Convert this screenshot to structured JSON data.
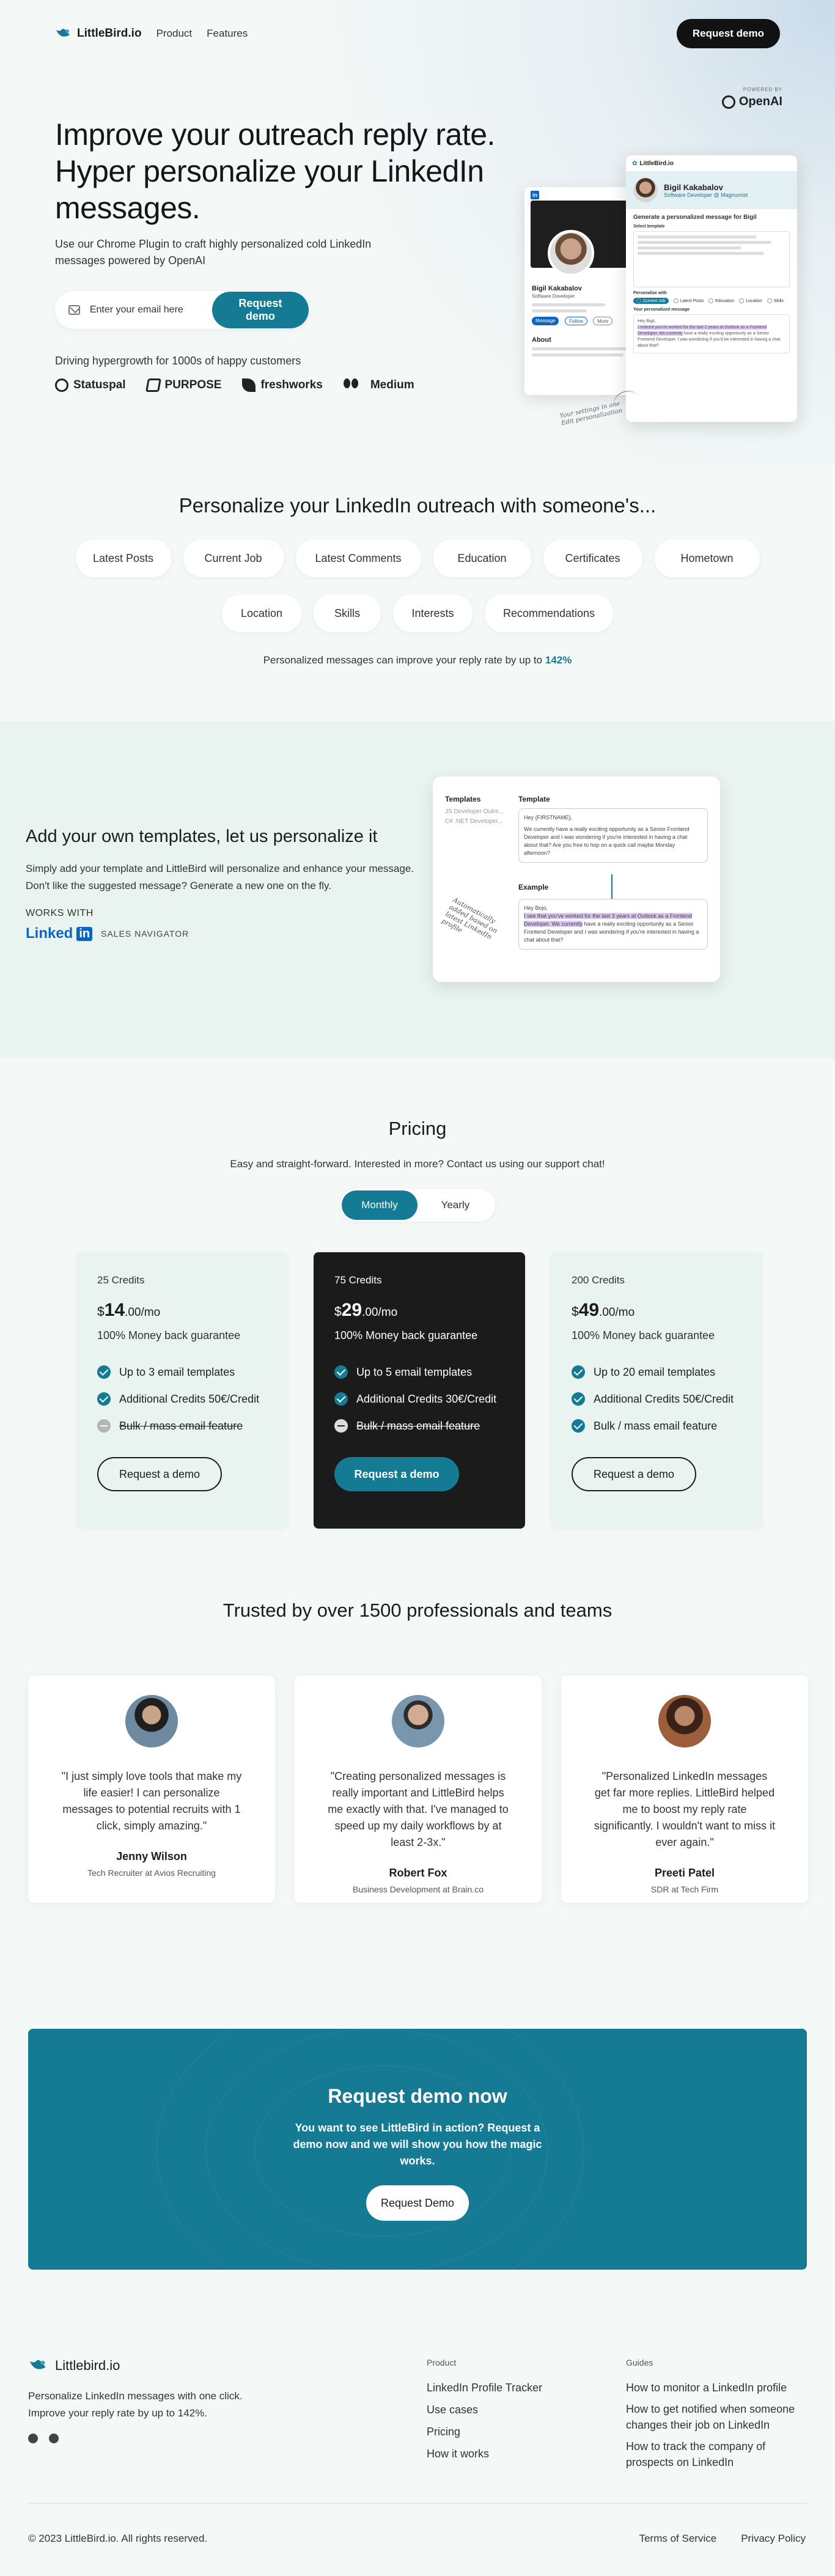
{
  "nav": {
    "logo": "LittleBird.io",
    "links": [
      "Product",
      "Features"
    ],
    "cta": "Request demo"
  },
  "powered": {
    "label": "POWERED BY",
    "brand": "OpenAI"
  },
  "hero": {
    "headline": "Improve your outreach reply rate. Hyper personalize your LinkedIn messages.",
    "subtitle": "Use our Chrome Plugin to craft highly personalized cold LinkedIn messages powered by OpenAI",
    "email_placeholder": "Enter your email here",
    "email_button": "Request demo",
    "driving": "Driving hypergrowth for 1000s of happy customers",
    "customers": [
      "Statuspal",
      "PURPOSE",
      "freshworks",
      "Medium"
    ],
    "mock": {
      "app_name": "LittleBird.io",
      "profile_name": "Bigil Kakabalov",
      "profile_role": "Software Developer @ Magnumist",
      "section_title": "Generate a personalized message for Bigil",
      "select_template": "Select template",
      "personalize_with": "Personalize with",
      "options": [
        "Current Job",
        "Latest Posts",
        "Education",
        "Location",
        "Skills"
      ],
      "message_label": "Your personalized message",
      "message_greeting": "Hey Bigil,",
      "message_highlight": "I noticed you've worked for the last 2 years at Outlook as a Frontend Developer. Ms currently",
      "message_rest": "have a really exciting opportunity as a Senior Frontend Developer. I was wondering if you'd be interested in having a chat about that?",
      "back_name": "Bigil Kakabalov",
      "back_role": "Software Developer",
      "back_about": "About",
      "back_button": "Message",
      "back_follow": "Follow",
      "back_more": "More"
    },
    "handwriting": "Your settings in one Edit personalization"
  },
  "personalize": {
    "title": "Personalize your LinkedIn outreach with someone's...",
    "chips": [
      "Latest Posts",
      "Current Job",
      "Latest Comments",
      "Education",
      "Certificates",
      "Hometown",
      "Location",
      "Skills",
      "Interests",
      "Recommendations"
    ],
    "footer_text": "Personalized messages can improve your reply rate by up to",
    "footer_value": "142%"
  },
  "templates": {
    "title": "Add your own templates, let us personalize it",
    "description": "Simply add your template and LittleBird will personalize and enhance your message. Don't like the suggested message? Generate a new one on the fly.",
    "works_with": "WORKS WITH",
    "linkedin_word": "Linked",
    "linkedin_box": "in",
    "sales_navigator": "SALES NAVIGATOR",
    "card": {
      "col_templates": "Templates",
      "col_template": "Template",
      "list": [
        "JS Developer Outre...",
        "C# .NET Developer..."
      ],
      "template_greeting": "Hey {FIRSTNAME},",
      "template_body": "We currently have a really exciting opportunity as a Senior Frontend Developer and I was wondering if you're interested in having a chat about that? Are you free to hop on a quick call maybe Monday afternoon?",
      "example_label": "Example",
      "example_greeting": "Hey Bojo,",
      "example_highlight": "I see that you've worked for the last 3 years at Outlook as a Frontend Developer. We currently",
      "example_rest": "have a really exciting opportunity as a Senior Frontend Developer and I was wondering if you're interested in having a chat about that?",
      "handwriting": "Automatically added based on latest LinkedIn profile"
    }
  },
  "pricing": {
    "title": "Pricing",
    "subtitle": "Easy and straight-forward. Interested in more? Contact us using our support chat!",
    "toggle": [
      "Monthly",
      "Yearly"
    ],
    "plans": [
      {
        "credits": "25 Credits",
        "currency": "$",
        "amount": "14",
        "cents": ".00/mo",
        "guarantee": "100% Money back guarantee",
        "features": [
          {
            "text": "Up to 3 email templates",
            "included": true
          },
          {
            "text": "Additional Credits 50€/Credit",
            "included": true
          },
          {
            "text": "Bulk / mass email feature",
            "included": false
          }
        ],
        "button": "Request a demo"
      },
      {
        "credits": "75 Credits",
        "currency": "$",
        "amount": "29",
        "cents": ".00/mo",
        "guarantee": "100% Money back guarantee",
        "features": [
          {
            "text": "Up to 5 email templates",
            "included": true
          },
          {
            "text": "Additional Credits 30€/Credit",
            "included": true
          },
          {
            "text": "Bulk / mass email feature",
            "included": false
          }
        ],
        "button": "Request a demo"
      },
      {
        "credits": "200 Credits",
        "currency": "$",
        "amount": "49",
        "cents": ".00/mo",
        "guarantee": "100% Money back guarantee",
        "features": [
          {
            "text": "Up to 20 email templates",
            "included": true
          },
          {
            "text": "Additional Credits 50€/Credit",
            "included": true
          },
          {
            "text": "Bulk / mass email feature",
            "included": true
          }
        ],
        "button": "Request a demo"
      }
    ]
  },
  "trust": {
    "title": "Trusted by over 1500 professionals and teams",
    "testimonials": [
      {
        "quote": "\"I just simply love tools that make my life easier! I can personalize messages to potential recruits with 1 click, simply amazing.\"",
        "name": "Jenny Wilson",
        "role": "Tech Recruiter at Avios Recruiting"
      },
      {
        "quote": "\"Creating personalized messages is really important and LittleBird helps me exactly with that. I've managed to speed up my daily workflows by at least 2-3x.\"",
        "name": "Robert Fox",
        "role": "Business Development at Brain.co"
      },
      {
        "quote": "\"Personalized LinkedIn messages get far more replies. LittleBird helped me to boost my reply rate significantly. I wouldn't want to miss it ever again.\"",
        "name": "Preeti Patel",
        "role": "SDR at Tech Firm"
      }
    ]
  },
  "demo": {
    "title": "Request demo now",
    "text": "You want to see LittleBird in action? Request a demo now and we will show you how the magic works.",
    "button": "Request Demo"
  },
  "footer": {
    "logo": "Littlebird.io",
    "description": "Personalize LinkedIn messages with one click. Improve your reply rate by up to 142%.",
    "product_title": "Product",
    "product_links": [
      "LinkedIn Profile Tracker",
      "Use cases",
      "Pricing",
      "How it works"
    ],
    "guides_title": "Guides",
    "guides_links": [
      "How to monitor a LinkedIn profile",
      "How to get notified when someone changes their job on LinkedIn",
      "How to track the company of prospects on LinkedIn"
    ],
    "copyright": "© 2023 LittleBird.io. All rights reserved.",
    "legal": [
      "Terms of Service",
      "Privacy Policy"
    ]
  },
  "colors": {
    "accent": "#157a93",
    "dark": "#1b1b1b",
    "background": "#f4f8f7",
    "mint": "#e9f3f0"
  }
}
